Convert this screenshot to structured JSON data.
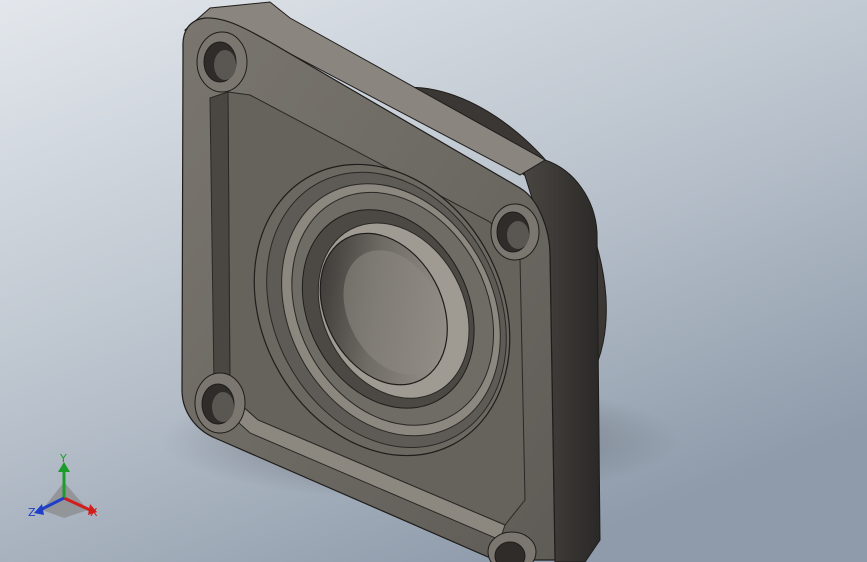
{
  "viewport": {
    "background_top": "#dfe3e9",
    "background_bottom": "#9aa6b3",
    "part_color": "#6e6a64",
    "part_dark": "#3f3c39",
    "part_edge": "#1f1d1b",
    "part_highlight": "#9b968e"
  },
  "triad": {
    "x_label": "X",
    "y_label": "Y",
    "z_label": "Z",
    "x_color": "#d21d1d",
    "y_color": "#1c9c2a",
    "z_color": "#1f3fc8"
  }
}
